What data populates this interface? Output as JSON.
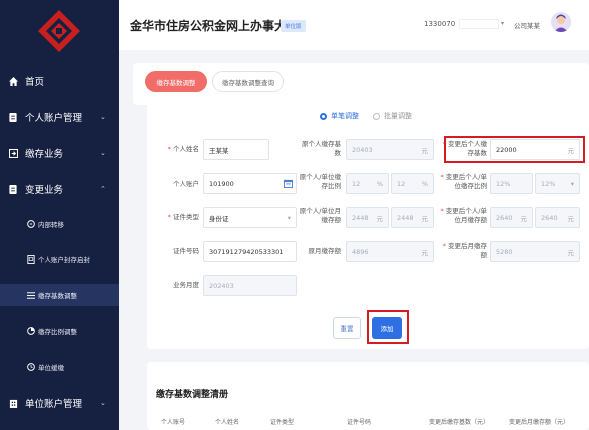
{
  "header": {
    "title": "金华市住房公积金网上办事大厅",
    "badge": "单位版",
    "phone": "1330070",
    "company": "公司某某"
  },
  "sidebar": {
    "items": [
      {
        "label": "首页",
        "icon": "home-icon"
      },
      {
        "label": "个人账户管理",
        "icon": "user-account-icon"
      },
      {
        "label": "缴存业务",
        "icon": "deposit-icon"
      },
      {
        "label": "变更业务",
        "icon": "change-icon"
      },
      {
        "label": "单位账户管理",
        "icon": "unit-account-icon"
      }
    ],
    "sub_items": [
      {
        "label": "内部转移",
        "icon": "transfer-icon"
      },
      {
        "label": "个人账户封存启封",
        "icon": "seal-icon"
      },
      {
        "label": "缴存基数调整",
        "icon": "list-icon"
      },
      {
        "label": "缴存比例调整",
        "icon": "pie-icon"
      },
      {
        "label": "单位缓缴",
        "icon": "defer-icon"
      }
    ]
  },
  "tabs": [
    "缴存基数调整",
    "缴存基数调整查询"
  ],
  "form": {
    "radio_single": "单笔调整",
    "radio_batch": "批量调整",
    "name_label": "个人姓名",
    "name_value": "王某某",
    "orig_base_label": "原个人缴存基数",
    "orig_base_value": "20403",
    "unit_yuan": "元",
    "new_base_label": "变更后个人缴存基数",
    "new_base_value": "22000",
    "account_label": "个人账户",
    "account_value": "101900",
    "orig_ratio_label": "原个人/单位缴存比例",
    "orig_ratio_personal": "12",
    "orig_ratio_unit": "12",
    "unit_pct": "%",
    "new_ratio_label": "变更后个人/单位缴存比例",
    "new_ratio_personal": "12%",
    "new_ratio_unit": "12%",
    "idtype_label": "证件类型",
    "idtype_value": "身份证",
    "orig_monthly_label": "原个人/单位月缴存额",
    "orig_monthly_personal": "2448",
    "orig_monthly_unit": "2448",
    "new_monthly_label": "变更后个人/单位月缴存额",
    "new_monthly_personal": "2640",
    "new_monthly_unit": "2640",
    "idno_label": "证件号码",
    "idno_value": "307191279420533301",
    "orig_total_label": "原月缴存额",
    "orig_total_value": "4896",
    "new_total_label": "变更后月缴存额",
    "new_total_value": "5280",
    "month_label": "业务月度",
    "month_value": "202403",
    "reset_label": "重置",
    "add_label": "添加"
  },
  "list": {
    "title": "缴存基数调整清册",
    "columns": [
      "个人账号",
      "个人姓名",
      "证件类型",
      "证件号码",
      "变更后缴存基数（元）",
      "变更后月缴存额（元）"
    ]
  },
  "colors": {
    "sidebar_bg": "#162041",
    "accent_red": "#f06d68",
    "primary_blue": "#2f6fe4",
    "highlight": "#d61b22"
  }
}
